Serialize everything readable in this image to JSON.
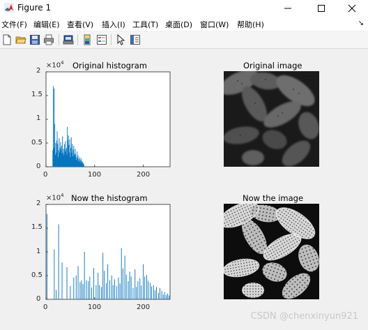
{
  "window": {
    "title": "Figure 1"
  },
  "menu": [
    {
      "label": "文件(F)"
    },
    {
      "label": "编辑(E)"
    },
    {
      "label": "查看(V)"
    },
    {
      "label": "插入(I)"
    },
    {
      "label": "工具(T)"
    },
    {
      "label": "桌面(D)"
    },
    {
      "label": "窗口(W)"
    },
    {
      "label": "帮助(H)"
    }
  ],
  "toolbar": [
    "new-file-icon",
    "open-folder-icon",
    "save-icon",
    "print-icon",
    "print-preview-icon",
    "colorbar-icon",
    "legend-icon",
    "pointer-icon",
    "property-editor-icon"
  ],
  "colors": {
    "bar": "#0072bd",
    "axes": "#262626",
    "bg": "#f0f0f0"
  },
  "plots": {
    "hist1": {
      "title": "Original histogram",
      "exponent": "×10",
      "exponent_power": "4",
      "yticks": [
        "2",
        "1.5",
        "1",
        "0.5",
        "0"
      ],
      "xticks": [
        "0",
        "100",
        "200"
      ]
    },
    "img1": {
      "title": "Original image"
    },
    "hist2": {
      "title": "Now the histogram",
      "exponent": "×10",
      "exponent_power": "4",
      "yticks": [
        "2",
        "1.5",
        "1",
        "0.5",
        "0"
      ],
      "xticks": [
        "0",
        "100",
        "200"
      ]
    },
    "img2": {
      "title": "Now the image"
    }
  },
  "chart_data": [
    {
      "type": "bar",
      "title": "Original histogram",
      "xlim": [
        0,
        255
      ],
      "ylim": [
        0,
        20000
      ],
      "x": [
        14,
        15,
        16,
        17,
        18,
        19,
        20,
        21,
        22,
        23,
        24,
        25,
        26,
        27,
        28,
        29,
        30,
        31,
        32,
        33,
        34,
        35,
        36,
        37,
        38,
        39,
        40,
        41,
        42,
        43,
        44,
        45,
        46,
        47,
        48,
        49,
        50,
        51,
        52,
        53,
        54,
        55,
        56,
        57,
        58,
        59,
        60,
        61,
        62,
        63,
        64,
        65,
        66,
        67,
        68,
        69,
        70,
        71,
        72,
        73,
        74,
        75,
        76,
        77,
        78
      ],
      "values": [
        3500,
        17000,
        4000,
        16500,
        9000,
        2500,
        5000,
        3000,
        5500,
        7500,
        4800,
        2000,
        3500,
        6000,
        3000,
        4000,
        5200,
        3600,
        4400,
        2800,
        6400,
        3000,
        3800,
        2400,
        4800,
        3200,
        5400,
        3600,
        4000,
        2600,
        8400,
        5600,
        6600,
        4600,
        3000,
        5800,
        2000,
        4000,
        6200,
        3000,
        4800,
        2200,
        3600,
        4400,
        2400,
        2800,
        3800,
        2600,
        1400,
        2000,
        3200,
        1800,
        2400,
        1200,
        1600,
        2000,
        1000,
        1400,
        1800,
        800,
        1200,
        1000,
        600,
        800,
        400
      ]
    },
    {
      "type": "bar",
      "title": "Now the histogram",
      "xlim": [
        0,
        255
      ],
      "ylim": [
        0,
        20000
      ],
      "x": [
        2,
        17,
        21,
        26,
        33,
        43,
        50,
        57,
        62,
        66,
        70,
        73,
        76,
        79,
        83,
        87,
        90,
        94,
        98,
        103,
        107,
        110,
        114,
        117,
        120,
        124,
        127,
        131,
        135,
        138,
        141,
        145,
        149,
        152,
        155,
        158,
        162,
        165,
        169,
        172,
        175,
        179,
        183,
        186,
        189,
        193,
        196,
        200,
        203,
        207,
        210,
        214,
        217,
        221,
        224,
        227,
        231,
        234,
        238,
        241,
        244,
        247,
        250,
        253
      ],
      "values": [
        18000,
        10500,
        2000,
        15800,
        7800,
        6800,
        2800,
        4600,
        5000,
        7000,
        3600,
        4000,
        3200,
        10000,
        4000,
        3800,
        4800,
        2500,
        6600,
        3000,
        5600,
        3000,
        2600,
        9800,
        6000,
        3400,
        7400,
        4000,
        5000,
        3000,
        4200,
        2800,
        4600,
        3300,
        10800,
        6500,
        9200,
        5200,
        3800,
        5800,
        4800,
        2400,
        6300,
        2600,
        3800,
        4400,
        2900,
        7400,
        4800,
        5100,
        3900,
        3500,
        2700,
        3000,
        1900,
        2600,
        1400,
        2400,
        1800,
        1000,
        1500,
        900,
        1200,
        800
      ]
    }
  ],
  "watermark": "CSDN @chenxinyun921"
}
